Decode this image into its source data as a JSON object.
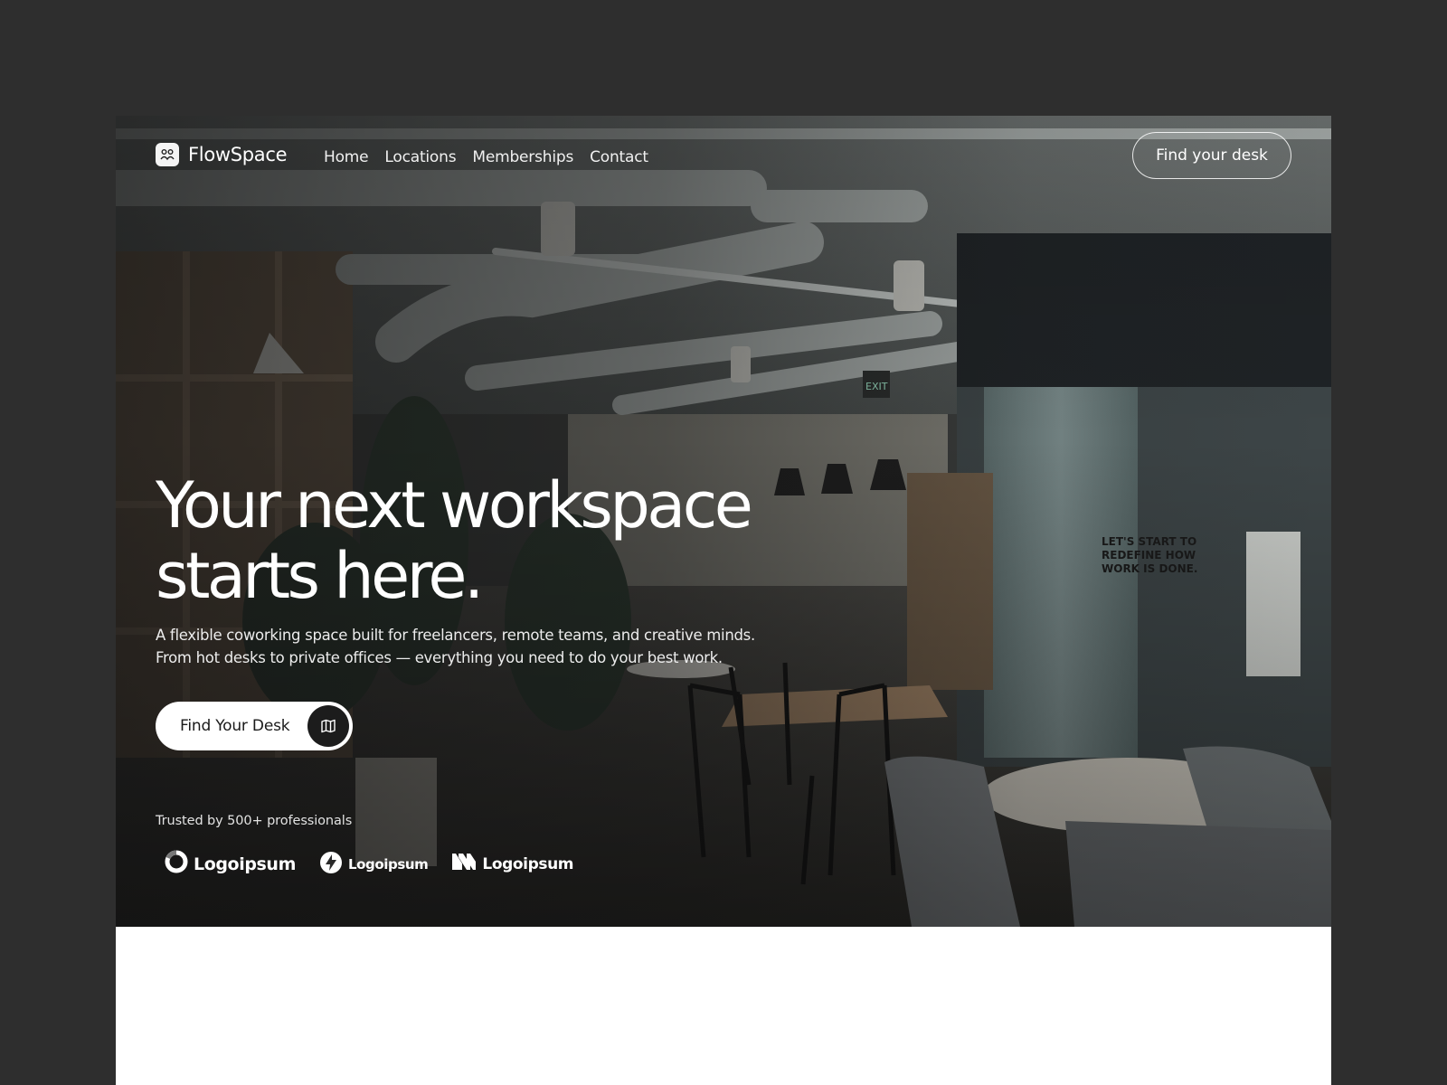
{
  "brand": {
    "name": "FlowSpace",
    "logo_icon": "people-group-icon"
  },
  "nav": {
    "links": [
      "Home",
      "Locations",
      "Memberships",
      "Contact"
    ],
    "cta_label": "Find your desk"
  },
  "hero": {
    "headline_line1": "Your next workspace",
    "headline_line2": "starts here.",
    "subcopy_line1": "A flexible coworking space built for freelancers, remote teams, and creative minds.",
    "subcopy_line2": "From hot desks to private offices — everything you need to do your best work.",
    "cta_label": "Find Your Desk",
    "cta_icon": "map-icon",
    "trusted_text": "Trusted by 500+ professionals",
    "partner_logos": [
      {
        "name": "Logoipsum",
        "icon": "ring-logo-icon"
      },
      {
        "name": "Logoipsum",
        "icon": "bolt-logo-icon"
      },
      {
        "name": "Logoipsum",
        "icon": "stripes-logo-icon"
      }
    ],
    "photo_signage": {
      "exit_sign": "EXIT",
      "wall_quote": "LET'S START TO REDEFINE HOW WORK IS DONE."
    }
  },
  "colors": {
    "page_background": "#2e2e2e",
    "hero_text": "#ffffff",
    "button_dark": "#1c1c1c",
    "frame_background": "#ffffff"
  }
}
